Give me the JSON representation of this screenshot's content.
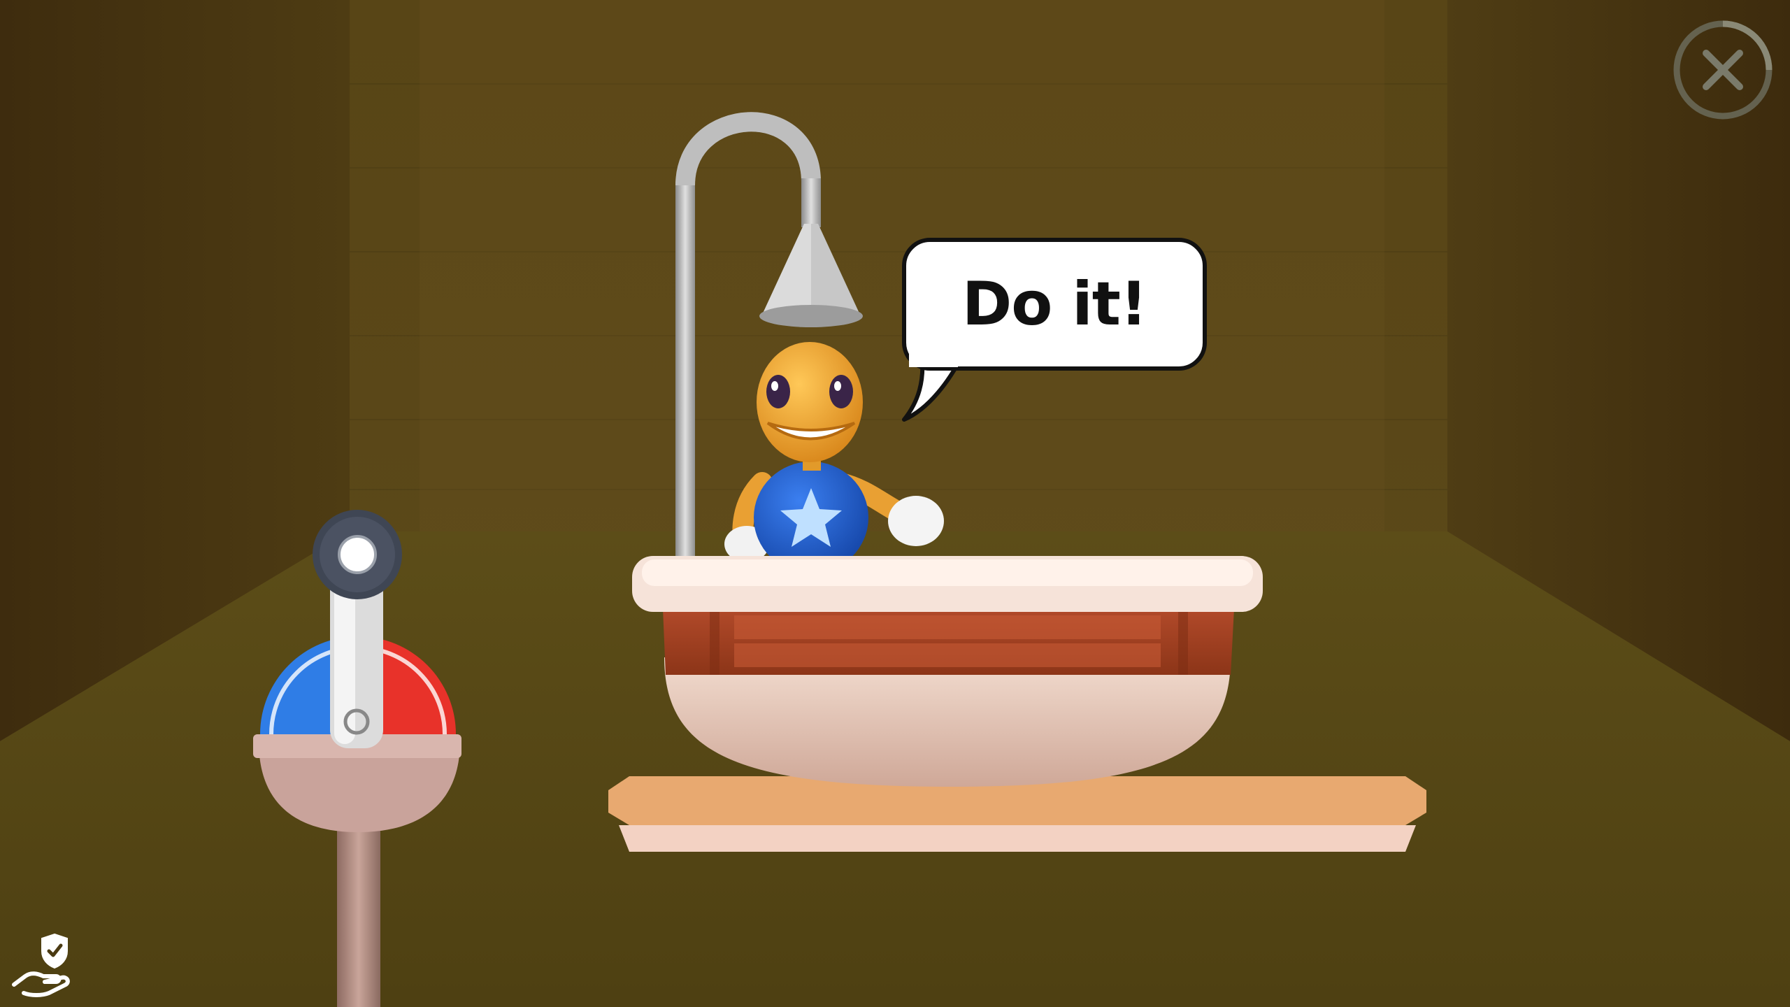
{
  "speech_bubble": {
    "text": "Do it!"
  },
  "icons": {
    "close": "close-icon",
    "privacy": "shield-hand-icon"
  },
  "colors": {
    "cold": "#2f7de6",
    "hot": "#e8322a",
    "wall": "#5a4517",
    "floor": "#5a4a17",
    "character_skin": "#f0a92c",
    "character_shirt": "#1f5fd1"
  },
  "lever": {
    "levels": [
      "cold",
      "hot"
    ],
    "position": 0.5
  }
}
